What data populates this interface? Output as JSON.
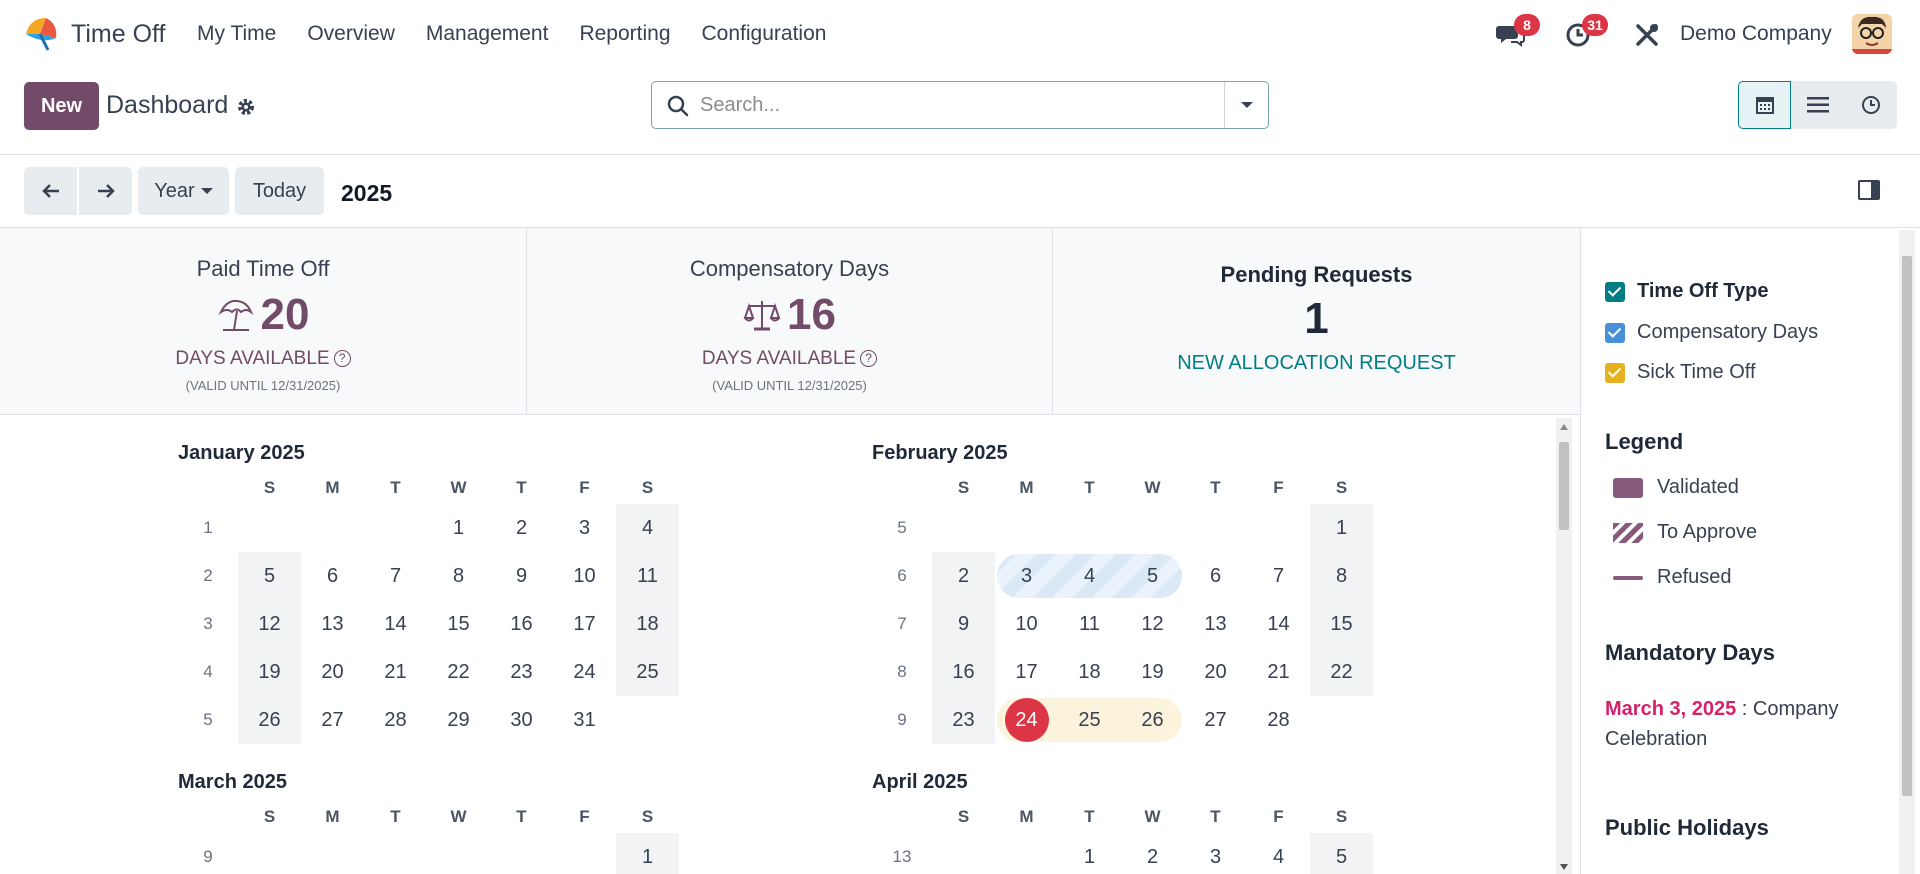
{
  "app": {
    "name": "Time Off"
  },
  "nav": [
    "My Time",
    "Overview",
    "Management",
    "Reporting",
    "Configuration"
  ],
  "systray": {
    "messages_count": "8",
    "activities_count": "31",
    "company": "Demo Company"
  },
  "control": {
    "new_label": "New",
    "breadcrumb": "Dashboard",
    "search_placeholder": "Search..."
  },
  "toolbar": {
    "range_label": "Year",
    "today_label": "Today",
    "year": "2025"
  },
  "stats": [
    {
      "title": "Paid Time Off",
      "value": "20",
      "sub": "DAYS AVAILABLE",
      "valid": "(VALID UNTIL 12/31/2025)"
    },
    {
      "title": "Compensatory Days",
      "value": "16",
      "sub": "DAYS AVAILABLE",
      "valid": "(VALID UNTIL 12/31/2025)"
    },
    {
      "title": "Pending Requests",
      "value": "1",
      "link": "NEW ALLOCATION REQUEST"
    }
  ],
  "calendar": {
    "dow": [
      "S",
      "M",
      "T",
      "W",
      "T",
      "F",
      "S"
    ],
    "months": [
      {
        "title": "January 2025",
        "weeks": [
          {
            "wk": "1",
            "days": [
              "",
              "",
              "",
              "1",
              "2",
              "3",
              "4"
            ]
          },
          {
            "wk": "2",
            "days": [
              "5",
              "6",
              "7",
              "8",
              "9",
              "10",
              "11"
            ]
          },
          {
            "wk": "3",
            "days": [
              "12",
              "13",
              "14",
              "15",
              "16",
              "17",
              "18"
            ]
          },
          {
            "wk": "4",
            "days": [
              "19",
              "20",
              "21",
              "22",
              "23",
              "24",
              "25"
            ]
          },
          {
            "wk": "5",
            "days": [
              "26",
              "27",
              "28",
              "29",
              "30",
              "31",
              ""
            ]
          }
        ]
      },
      {
        "title": "February 2025",
        "weeks": [
          {
            "wk": "5",
            "days": [
              "",
              "",
              "",
              "",
              "",
              "",
              "1"
            ]
          },
          {
            "wk": "6",
            "days": [
              "2",
              "3",
              "4",
              "5",
              "6",
              "7",
              "8"
            ]
          },
          {
            "wk": "7",
            "days": [
              "9",
              "10",
              "11",
              "12",
              "13",
              "14",
              "15"
            ]
          },
          {
            "wk": "8",
            "days": [
              "16",
              "17",
              "18",
              "19",
              "20",
              "21",
              "22"
            ]
          },
          {
            "wk": "9",
            "days": [
              "23",
              "24",
              "25",
              "26",
              "27",
              "28",
              ""
            ]
          }
        ]
      },
      {
        "title": "March 2025",
        "weeks": [
          {
            "wk": "9",
            "days": [
              "",
              "",
              "",
              "",
              "",
              "",
              "1"
            ]
          }
        ]
      },
      {
        "title": "April 2025",
        "weeks": [
          {
            "wk": "13",
            "days": [
              "",
              "",
              "1",
              "2",
              "3",
              "4",
              "5"
            ]
          }
        ]
      }
    ]
  },
  "side": {
    "filters": [
      {
        "label": "Time Off Type",
        "color": "#017e84",
        "bold": true
      },
      {
        "label": "Compensatory Days",
        "color": "#4a90d9",
        "bold": false
      },
      {
        "label": "Sick Time Off",
        "color": "#e6b120",
        "bold": false
      }
    ],
    "legend_title": "Legend",
    "legend": [
      "Validated",
      "To Approve",
      "Refused"
    ],
    "mandatory_title": "Mandatory Days",
    "mandatory_date": "March 3, 2025",
    "mandatory_desc": " : Company Celebration",
    "holidays_title": "Public Holidays"
  },
  "colors": {
    "brand": "#714B67",
    "accent": "#017e84",
    "today": "#dc3545"
  }
}
